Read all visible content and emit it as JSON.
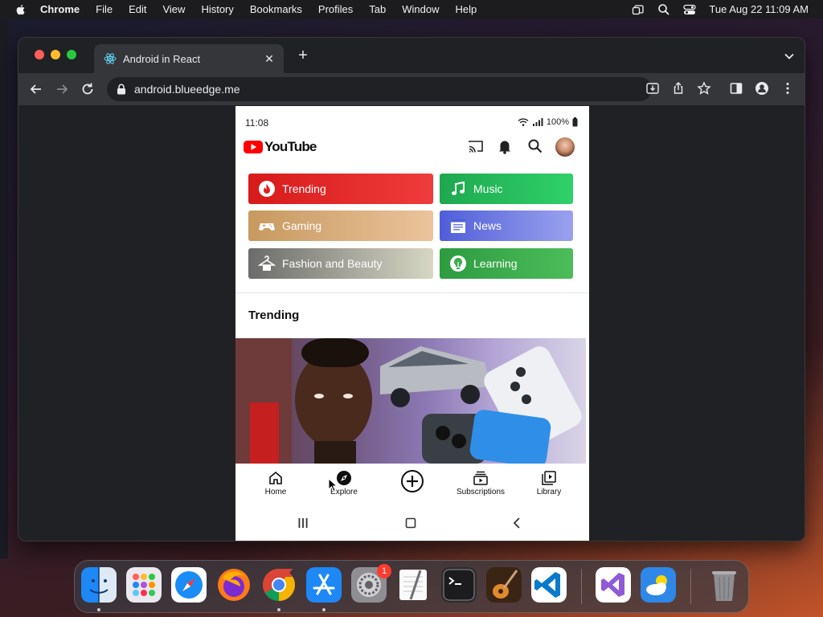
{
  "menubar": {
    "app": "Chrome",
    "items": [
      "File",
      "Edit",
      "View",
      "History",
      "Bookmarks",
      "Profiles",
      "Tab",
      "Window",
      "Help"
    ],
    "datetime": "Tue Aug 22  11:09 AM"
  },
  "browser": {
    "tab_title": "Android in React",
    "url": "android.blueedge.me"
  },
  "phone": {
    "status": {
      "time": "11:08",
      "battery": "100%"
    },
    "app_name": "YouTube",
    "categories": [
      {
        "label": "Trending",
        "color": "#e02020"
      },
      {
        "label": "Music",
        "color": "#22c15c"
      },
      {
        "label": "Gaming",
        "color": "#d9aa78"
      },
      {
        "label": "News",
        "color": "#6f7be3"
      },
      {
        "label": "Fashion and Beauty",
        "color": "#a0a090"
      },
      {
        "label": "Learning",
        "color": "#3cac4d"
      }
    ],
    "section_title": "Trending",
    "bottom_nav": [
      "Home",
      "Explore",
      "Subscriptions",
      "Library"
    ]
  },
  "dock": {
    "apps": [
      "finder-icon",
      "launchpad-icon",
      "safari-icon",
      "firefox-icon",
      "chrome-icon",
      "app-store-icon",
      "system-settings-icon",
      "textedit-icon",
      "terminal-icon",
      "garageband-icon",
      "vscode-icon",
      "visual-studio-icon",
      "weather-icon",
      "trash-icon"
    ],
    "settings_badge": "1"
  }
}
